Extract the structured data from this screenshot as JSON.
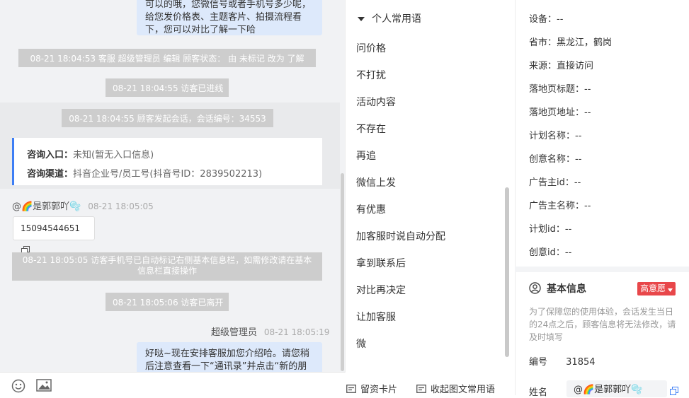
{
  "chat": {
    "top_bubble_lines": [
      "可以的哦，您微信号或者手机号多少呢，",
      "给您发价格表、主题客片、拍摄流程看",
      "下，您可以对比了解一下哈"
    ],
    "sys_status_change": "08-21 18:04:53 客服 超级管理员 编辑 顾客状态： 由 未标记 改为 了解",
    "sys_visitor_enter": "08-21 18:04:55 访客已进线",
    "sys_session_start": "08-21 18:04:55 顾客发起会话，会话编号：34553",
    "card": {
      "entry_label": "咨询入口：",
      "entry_value": "未知(暂无入口信息)",
      "channel_label": "咨询渠道：",
      "channel_value": "抖音企业号/员工号(抖音号ID：2839502213)"
    },
    "visitor_name": "@🌈是郭郭吖🫧",
    "visitor_time": "08-21 18:05:05",
    "phone": "15094544651",
    "sys_auto_mark": "08-21 18:05:05 访客手机号已自动标记右侧基本信息栏，如需修改请在基本信息栏直接操作",
    "sys_visitor_left": "08-21 18:05:06 访客已离开",
    "agent_name": "超级管理员",
    "agent_time": "08-21 18:05:19",
    "bottom_bubble_lines": [
      "好哒~现在安排客服加您介绍哈。请您稍",
      "后注意查看一下“通讯录”并点击“新的朋"
    ]
  },
  "phrases": {
    "header": "个人常用语",
    "items": [
      "问价格",
      "不打扰",
      "活动内容",
      "不存在",
      "再追",
      "微信上发",
      "有优惠",
      "加客服时说自动分配",
      "拿到联系后",
      "对比再决定",
      "让加客服",
      "微"
    ],
    "footer_card": "留资卡片",
    "footer_collect": "收起图文常用语"
  },
  "info": {
    "rows": [
      {
        "label": "设备：",
        "value": "--"
      },
      {
        "label": "省市：",
        "value": "黑龙江，鹤岗"
      },
      {
        "label": "来源：",
        "value": "直接访问"
      },
      {
        "label": "落地页标题：",
        "value": "--"
      },
      {
        "label": "落地页地址：",
        "value": "--"
      },
      {
        "label": "计划名称：",
        "value": "--"
      },
      {
        "label": "创意名称：",
        "value": "--"
      },
      {
        "label": "广告主id：",
        "value": "--"
      },
      {
        "label": "广告主名称：",
        "value": "--"
      },
      {
        "label": "计划id：",
        "value": "--"
      },
      {
        "label": "创意id：",
        "value": "--"
      }
    ],
    "basic_title": "基本信息",
    "intent_tag": "高意愿",
    "hint": "为了保障您的使用体验，会话发生当日的24点之后，顾客信息将无法修改，请及时填写",
    "id_label": "编号",
    "id_value": "31854",
    "name_label": "姓名",
    "name_value": "@🌈是郭郭吖🫧"
  },
  "colors": {
    "accent": "#3d7ef5",
    "bubble": "#dde9fb",
    "system": "#cdcdcd",
    "tag": "#e8474a"
  }
}
